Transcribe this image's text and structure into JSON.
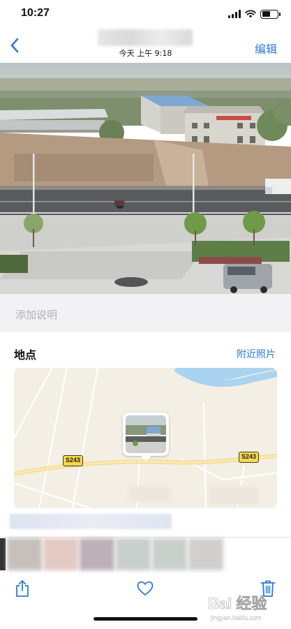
{
  "status_bar": {
    "time": "10:27"
  },
  "nav": {
    "subtitle": "今天  上午 9:18",
    "edit_label": "编辑"
  },
  "photo": {
    "banner_text": ""
  },
  "caption": {
    "placeholder": "添加说明"
  },
  "location": {
    "title": "地点",
    "nearby_label": "附近照片"
  },
  "map": {
    "road_shields": [
      "S243",
      "S243"
    ],
    "water_color": "#aad3ef",
    "land_color": "#f4efe4"
  },
  "toolbar": {
    "share_icon": "share-icon",
    "like_icon": "heart-icon",
    "delete_icon": "trash-icon"
  },
  "watermark": {
    "text": "Bai 经验",
    "subtext": "jingyan.baidu.com"
  },
  "colors": {
    "accent": "#2f7ad6"
  }
}
